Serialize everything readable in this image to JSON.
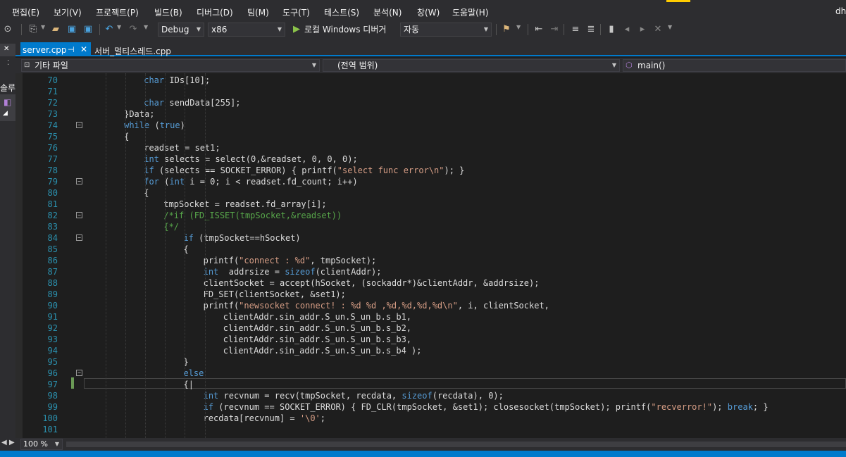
{
  "menu": {
    "items": [
      "편집(E)",
      "보기(V)",
      "프로젝트(P)",
      "빌드(B)",
      "디버그(D)",
      "팀(M)",
      "도구(T)",
      "테스트(S)",
      "분석(N)",
      "창(W)",
      "도움말(H)"
    ],
    "user_initials": "dh"
  },
  "toolbar": {
    "configuration": "Debug",
    "platform": "x86",
    "run_label": "로컬 Windows 디버거",
    "run_mode": "자동"
  },
  "tabs": {
    "active": "server.cpp",
    "second": "서버_멀티스레드.cpp"
  },
  "navbar": {
    "project": "기타 파일",
    "scope": "(전역 범위)",
    "member": "main()"
  },
  "left_panel": {
    "tab_label": "솔루"
  },
  "editor": {
    "lines": [
      {
        "n": "70",
        "indent": 8,
        "tokens": [
          [
            "kw",
            "char"
          ],
          [
            "p",
            " IDs[10];"
          ]
        ]
      },
      {
        "n": "71",
        "indent": 0,
        "tokens": []
      },
      {
        "n": "72",
        "indent": 8,
        "tokens": [
          [
            "kw",
            "char"
          ],
          [
            "p",
            " sendData[255];"
          ]
        ]
      },
      {
        "n": "73",
        "indent": 4,
        "tokens": [
          [
            "p",
            "}Data;"
          ]
        ]
      },
      {
        "n": "74",
        "indent": 4,
        "fold": true,
        "tokens": [
          [
            "kw",
            "while"
          ],
          [
            "p",
            " ("
          ],
          [
            "kw",
            "true"
          ],
          [
            "p",
            ")"
          ]
        ]
      },
      {
        "n": "75",
        "indent": 4,
        "tokens": [
          [
            "p",
            "{"
          ]
        ]
      },
      {
        "n": "76",
        "indent": 8,
        "tokens": [
          [
            "p",
            "readset = set1;"
          ]
        ]
      },
      {
        "n": "77",
        "indent": 8,
        "tokens": [
          [
            "kw",
            "int"
          ],
          [
            "p",
            " selects = select(0,&readset, 0, 0, 0);"
          ]
        ]
      },
      {
        "n": "78",
        "indent": 8,
        "tokens": [
          [
            "kw",
            "if"
          ],
          [
            "p",
            " (selects == SOCKET_ERROR) { printf("
          ],
          [
            "str",
            "\"select func error\\n\""
          ],
          [
            "p",
            "); }"
          ]
        ]
      },
      {
        "n": "79",
        "indent": 8,
        "fold": true,
        "tokens": [
          [
            "kw",
            "for"
          ],
          [
            "p",
            " ("
          ],
          [
            "kw",
            "int"
          ],
          [
            "p",
            " i = 0; i < readset.fd_count; i++)"
          ]
        ]
      },
      {
        "n": "80",
        "indent": 8,
        "tokens": [
          [
            "p",
            "{"
          ]
        ]
      },
      {
        "n": "81",
        "indent": 12,
        "tokens": [
          [
            "p",
            "tmpSocket = readset.fd_array[i];"
          ]
        ]
      },
      {
        "n": "82",
        "indent": 12,
        "fold": true,
        "tokens": [
          [
            "cmt",
            "/*if (FD_ISSET(tmpSocket,&readset))"
          ]
        ]
      },
      {
        "n": "83",
        "indent": 12,
        "tokens": [
          [
            "cmt",
            "{*/"
          ]
        ]
      },
      {
        "n": "84",
        "indent": 16,
        "fold": true,
        "tokens": [
          [
            "kw",
            "if"
          ],
          [
            "p",
            " (tmpSocket==hSocket)"
          ]
        ]
      },
      {
        "n": "85",
        "indent": 16,
        "tokens": [
          [
            "p",
            "{"
          ]
        ]
      },
      {
        "n": "86",
        "indent": 20,
        "tokens": [
          [
            "p",
            "printf("
          ],
          [
            "str",
            "\"connect : %d\""
          ],
          [
            "p",
            ", tmpSocket);"
          ]
        ]
      },
      {
        "n": "87",
        "indent": 20,
        "tokens": [
          [
            "kw",
            "int"
          ],
          [
            "p",
            "  addrsize = "
          ],
          [
            "kw",
            "sizeof"
          ],
          [
            "p",
            "(clientAddr);"
          ]
        ]
      },
      {
        "n": "88",
        "indent": 20,
        "tokens": [
          [
            "p",
            "clientSocket = accept(hSocket, (sockaddr*)&clientAddr, &addrsize);"
          ]
        ]
      },
      {
        "n": "89",
        "indent": 20,
        "tokens": [
          [
            "p",
            "FD_SET(clientSocket, &set1);"
          ]
        ]
      },
      {
        "n": "90",
        "indent": 20,
        "tokens": [
          [
            "p",
            "printf("
          ],
          [
            "str",
            "\"newsocket connect! : %d %d ,%d,%d,%d,%d\\n\""
          ],
          [
            "p",
            ", i, clientSocket,"
          ]
        ]
      },
      {
        "n": "91",
        "indent": 24,
        "tokens": [
          [
            "p",
            "clientAddr.sin_addr.S_un.S_un_b.s_b1,"
          ]
        ]
      },
      {
        "n": "92",
        "indent": 24,
        "tokens": [
          [
            "p",
            "clientAddr.sin_addr.S_un.S_un_b.s_b2,"
          ]
        ]
      },
      {
        "n": "93",
        "indent": 24,
        "tokens": [
          [
            "p",
            "clientAddr.sin_addr.S_un.S_un_b.s_b3,"
          ]
        ]
      },
      {
        "n": "94",
        "indent": 24,
        "tokens": [
          [
            "p",
            "clientAddr.sin_addr.S_un.S_un_b.s_b4 );"
          ]
        ]
      },
      {
        "n": "95",
        "indent": 16,
        "tokens": [
          [
            "p",
            "}"
          ]
        ]
      },
      {
        "n": "96",
        "indent": 16,
        "fold": true,
        "tokens": [
          [
            "kw",
            "else"
          ]
        ]
      },
      {
        "n": "97",
        "indent": 16,
        "tokens": [
          [
            "p",
            "{|"
          ]
        ]
      },
      {
        "n": "98",
        "indent": 20,
        "tokens": [
          [
            "kw",
            "int"
          ],
          [
            "p",
            " recvnum = recv(tmpSocket, recdata, "
          ],
          [
            "kw",
            "sizeof"
          ],
          [
            "p",
            "(recdata), 0);"
          ]
        ]
      },
      {
        "n": "99",
        "indent": 20,
        "tokens": [
          [
            "kw",
            "if"
          ],
          [
            "p",
            " (recvnum == SOCKET_ERROR) { FD_CLR(tmpSocket, &set1); closesocket(tmpSocket); printf("
          ],
          [
            "str",
            "\"recverror!\""
          ],
          [
            "p",
            "); "
          ],
          [
            "kw",
            "break"
          ],
          [
            "p",
            "; }"
          ]
        ]
      },
      {
        "n": "100",
        "indent": 20,
        "tokens": [
          [
            "p",
            "recdata[recvnum] = "
          ],
          [
            "str",
            "'\\0'"
          ],
          [
            "p",
            ";"
          ]
        ]
      },
      {
        "n": "101",
        "indent": 0,
        "tokens": []
      }
    ]
  },
  "statusbar": {
    "zoom": "100 %"
  },
  "colors": {
    "accent": "#007acc",
    "keyword": "#569cd6",
    "string": "#d69d85",
    "comment": "#57a64a",
    "line_number": "#2b91af"
  }
}
